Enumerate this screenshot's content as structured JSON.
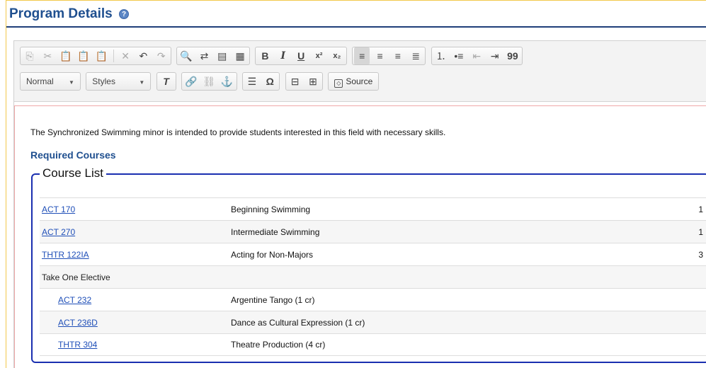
{
  "page": {
    "title": "Program Details",
    "help_icon": "?"
  },
  "toolbar": {
    "format_label": "Normal",
    "styles_label": "Styles",
    "source_label": "Source",
    "icons": {
      "bold": "B",
      "italic": "I",
      "underline": "U",
      "superscript": "x²",
      "subscript": "x₂",
      "special_char": "Ω",
      "blockquote": "99"
    }
  },
  "content": {
    "intro": "The Synchronized Swimming minor is intended to provide students interested in this field with necessary skills.",
    "required_heading": "Required Courses",
    "course_list_title": "Course List",
    "rows": [
      {
        "code": "ACT 170",
        "title": "Beginning Swimming",
        "credits": "1"
      },
      {
        "code": "ACT 270",
        "title": "Intermediate Swimming",
        "credits": "1"
      },
      {
        "code": "THTR 122IA",
        "title": "Acting for Non-Majors",
        "credits": "3"
      },
      {
        "label": "Take One Elective"
      },
      {
        "code": "ACT 232",
        "title": "Argentine Tango (1 cr)"
      },
      {
        "code": "ACT 236D",
        "title": "Dance as Cultural Expression (1 cr)"
      },
      {
        "code": "THTR 304",
        "title": "Theatre Production (4 cr)"
      }
    ]
  }
}
